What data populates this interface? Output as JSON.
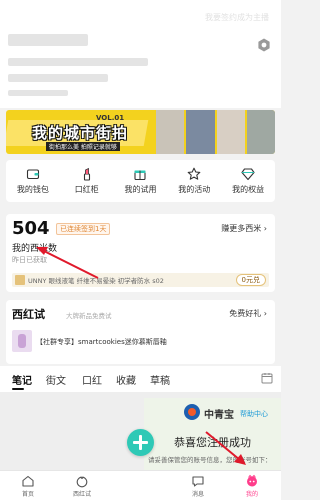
{
  "header": {
    "top_hint": "我要签约成为主播"
  },
  "banner": {
    "vol": "VOL.01",
    "title": "我的城市街拍",
    "subtitle": "街拍那么美 拍照记录就够"
  },
  "shortcuts": [
    {
      "label": "我的钱包",
      "icon": "wallet-icon"
    },
    {
      "label": "口红柜",
      "icon": "lipstick-icon"
    },
    {
      "label": "我的试用",
      "icon": "gift-box-icon"
    },
    {
      "label": "我的活动",
      "icon": "star-icon"
    },
    {
      "label": "我的权益",
      "icon": "diamond-icon"
    }
  ],
  "points": {
    "value": "504",
    "badge": "已连续签到1天",
    "earn_more": "赚更多西米 ›",
    "label": "我的西米数",
    "yesterday": "昨日已获取",
    "promo_text": "UNNY 眼线液笔 纤维不易晕染  初学者防水 s02",
    "promo_price": "0元兑"
  },
  "trial": {
    "title": "西红试",
    "subtitle": "大牌新品免费试",
    "more": "免费好礼 ›",
    "item_name": "【社群专享】smartcookies迷你慕斯唇釉"
  },
  "tabs": [
    "笔记",
    "街文",
    "口红",
    "收藏",
    "草稿"
  ],
  "popup": {
    "brand": "中青宝",
    "help": "帮助中心",
    "message": "恭喜您注册成功",
    "note": "请妥善保管您的账号信息，您的账号如下："
  },
  "nav": [
    {
      "label": "首页",
      "icon": "home-icon"
    },
    {
      "label": "西红试",
      "icon": "tomato-icon"
    },
    {
      "label": "消息",
      "icon": "message-icon"
    },
    {
      "label": "我的",
      "icon": "profile-icon"
    }
  ],
  "colors": {
    "accent": "#2ec9b6",
    "active_nav": "#ff3d8b",
    "banner_yellow": "#f3d21e",
    "arrow": "#e0192b"
  }
}
